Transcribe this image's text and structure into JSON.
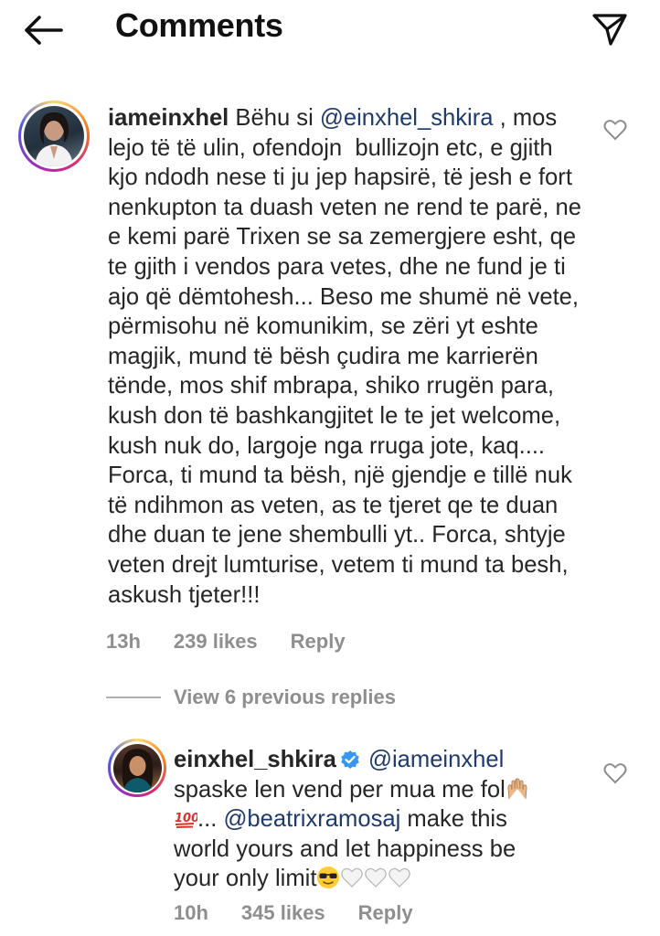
{
  "header": {
    "title": "Comments",
    "back_icon": "arrow-left-icon",
    "share_icon": "paper-plane-icon"
  },
  "comment_1": {
    "username": "iameinxhel",
    "text_before_mention": "Bëhu si ",
    "mention": "@einxhel_shkira",
    "text_after_mention": " , mos lejo të të ulin, ofendojn  bullizojn etc, e gjith kjo ndodh nese ti ju jep hapsirë, të jesh e fort nenkupton ta duash veten ne rend te parë, ne e kemi parë Trixen se sa zemergjere esht, qe te gjith i vendos para vetes, dhe ne fund je ti ajo që dëmtohesh... Beso me shumë në vete, përmisohu në komunikim, se zëri yt eshte magjik, mund të bësh çudira me karrierën tënde, mos shif mbrapa, shiko rrugën para, kush don të bashkangjitet le te jet welcome, kush nuk do, largoje nga rruga jote, kaq.... Forca, ti mund ta bësh, një gjendje e tillë nuk të ndihmon as veten, as te tjeret qe te duan dhe duan te jene shembulli yt.. Forca, shtyje veten drejt lumturise, vetem ti mund ta besh, askush tjeter!!!",
    "time": "13h",
    "likes": "239 likes",
    "reply_label": "Reply"
  },
  "view_replies": {
    "label": "View 6 previous replies"
  },
  "comment_2": {
    "username": "einxhel_shkira",
    "mention_1": "@iameinxhel",
    "text_1": "spaske len vend per mua me fol",
    "text_2": "... ",
    "mention_2": "@beatrixramosaj",
    "text_3": " make this world yours and let happiness be your only limit",
    "time": "10h",
    "likes": "345 likes",
    "reply_label": "Reply",
    "verified_icon": "verified-badge-icon"
  },
  "colors": {
    "text": "#262626",
    "muted": "#8e8e8e",
    "mention": "#1e3a6e",
    "verified": "#3897f0"
  }
}
